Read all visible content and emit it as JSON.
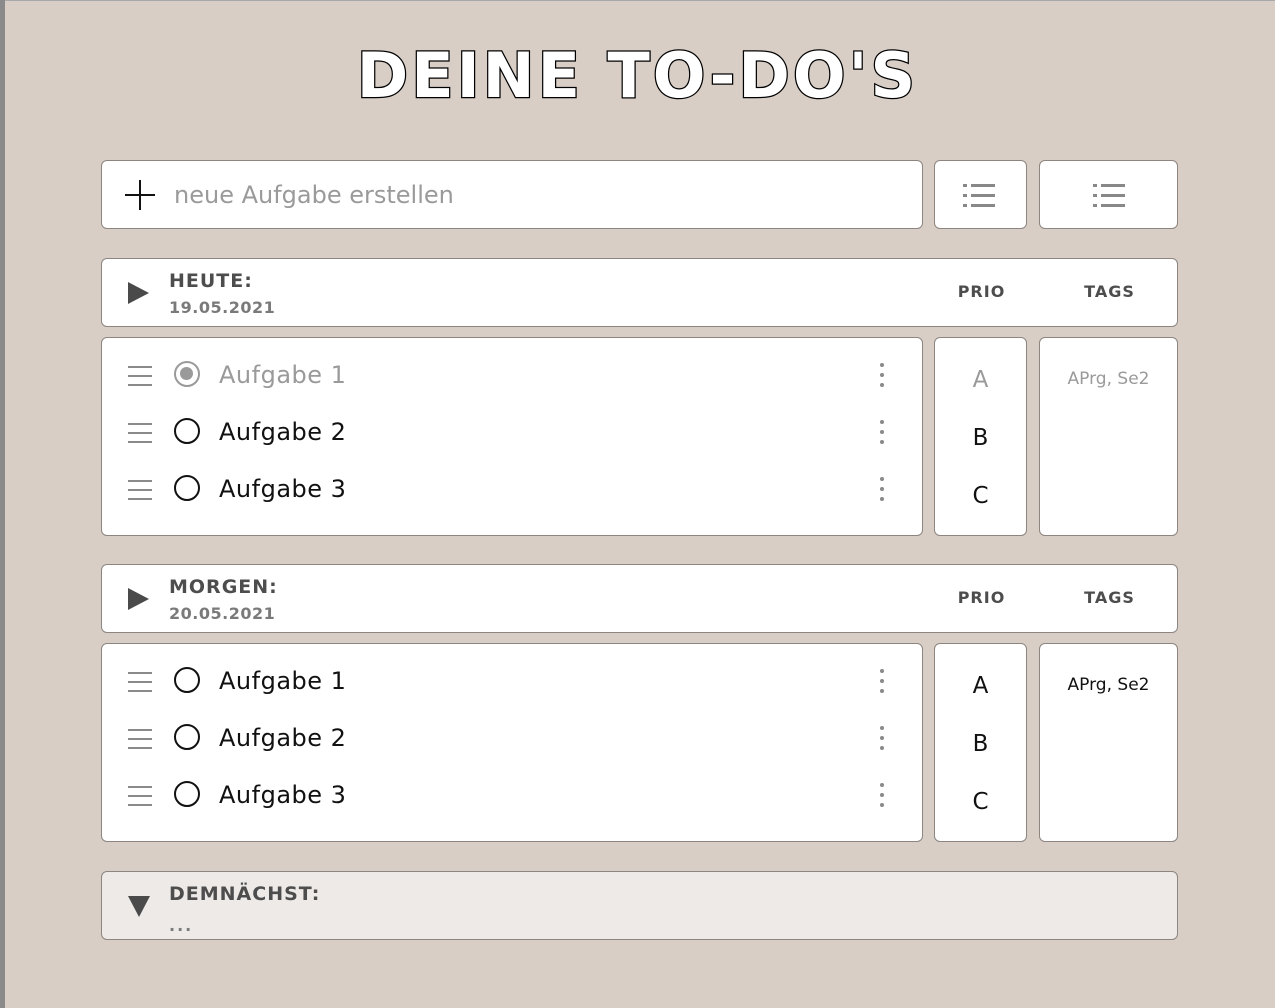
{
  "app": {
    "title": "DEINE TO-DO'S"
  },
  "new_task": {
    "placeholder": "neue Aufgabe erstellen",
    "add_icon": "plus-icon"
  },
  "toolbar": {
    "filter_icons": [
      "list-icon",
      "list-icon"
    ]
  },
  "columns": {
    "prio": "PRIO",
    "tags": "TAGS"
  },
  "sections": {
    "today": {
      "title": "HEUTE:",
      "date": "19.05.2021",
      "expanded_icon": "triangle-right-icon",
      "tasks": [
        {
          "label": "Aufgabe 1",
          "done": true,
          "prio": "A"
        },
        {
          "label": "Aufgabe 2",
          "done": false,
          "prio": "B"
        },
        {
          "label": "Aufgabe 3",
          "done": false,
          "prio": "C"
        }
      ],
      "tags": "APrg, Se2"
    },
    "tomorrow": {
      "title": "MORGEN:",
      "date": "20.05.2021",
      "expanded_icon": "triangle-right-icon",
      "tasks": [
        {
          "label": "Aufgabe 1",
          "done": false,
          "prio": "A"
        },
        {
          "label": "Aufgabe 2",
          "done": false,
          "prio": "B"
        },
        {
          "label": "Aufgabe 3",
          "done": false,
          "prio": "C"
        }
      ],
      "tags": "APrg, Se2"
    },
    "soon": {
      "title": "DEMNÄCHST:",
      "subtitle": "...",
      "expanded_icon": "triangle-down-icon"
    }
  },
  "colors": {
    "background": "#d8cec6",
    "panel": "#ffffff",
    "panel_muted": "#edeae7",
    "border": "#8c8580",
    "muted_text": "#9a9a9a",
    "header_text": "#4d4d4d"
  }
}
